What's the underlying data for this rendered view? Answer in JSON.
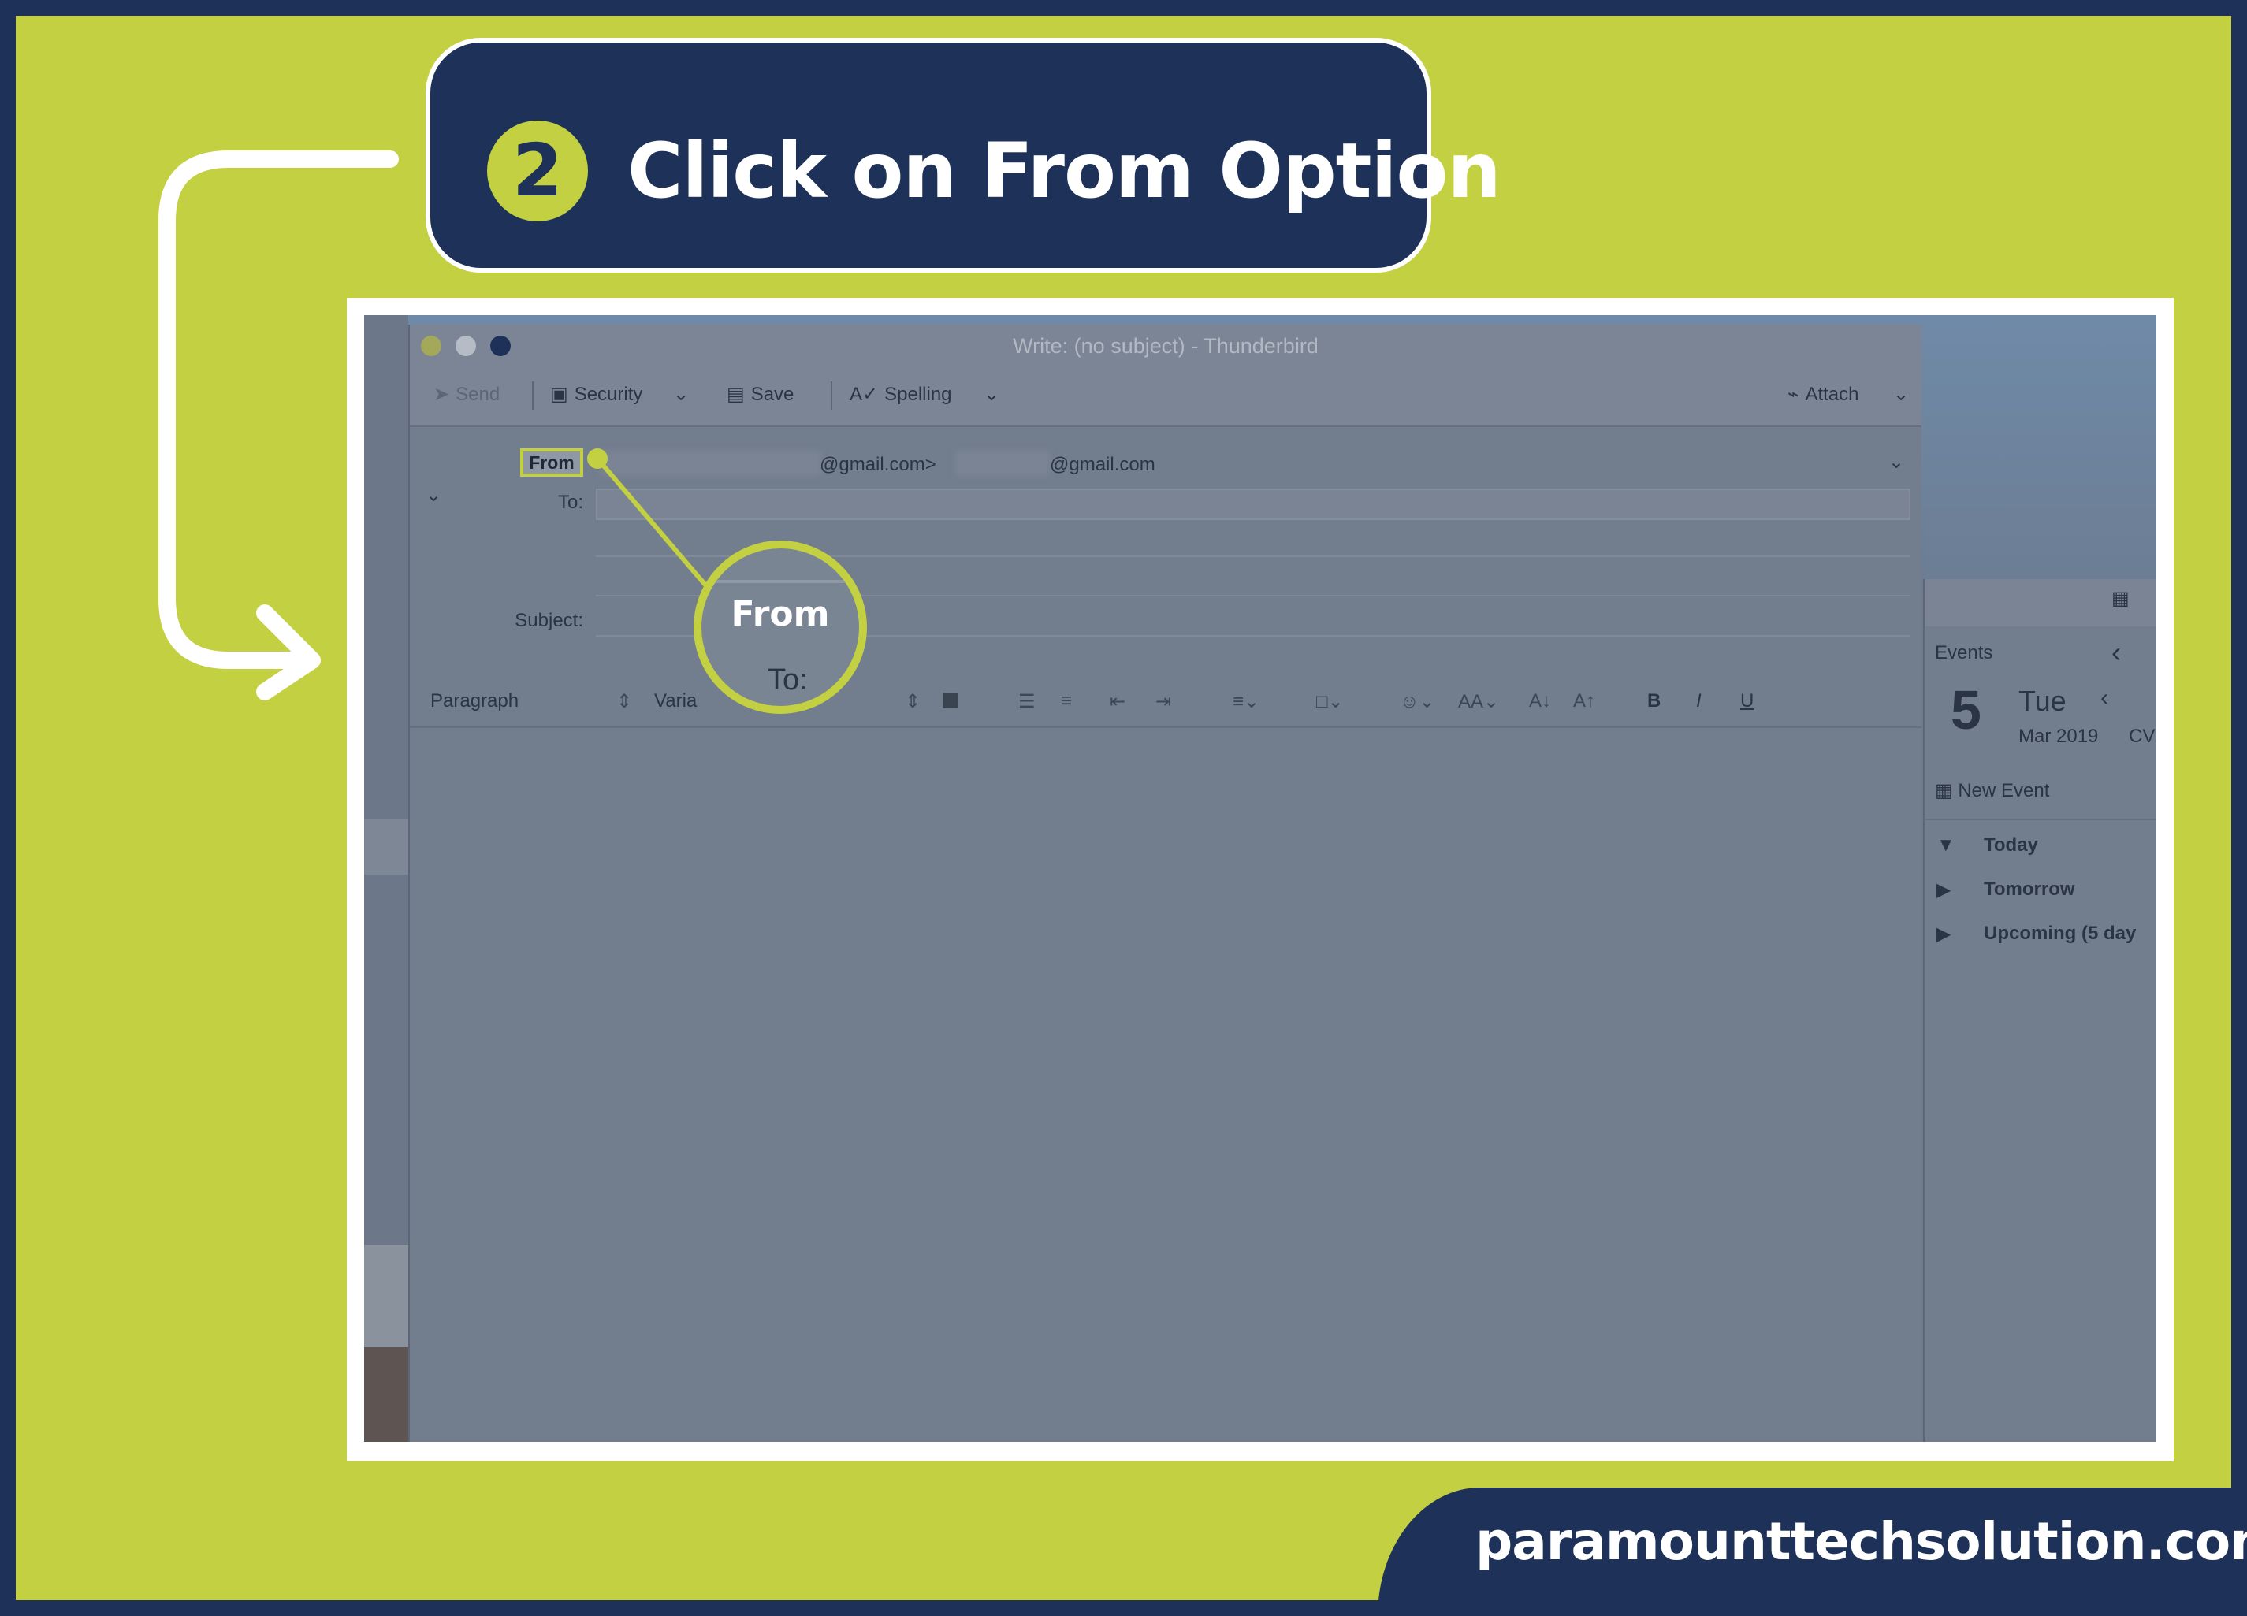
{
  "banner": {
    "step_number": "2",
    "text": "Click on From Option"
  },
  "window": {
    "title": "Write: (no subject) - Thunderbird",
    "toolbar": {
      "send": "Send",
      "security": "Security",
      "save": "Save",
      "spelling": "Spelling",
      "attach": "Attach"
    },
    "header": {
      "from_label": "From",
      "from_email_suffix": "@gmail.com>",
      "from_identity_suffix": "@gmail.com",
      "to_label": "To:",
      "subject_label": "Subject:"
    },
    "format": {
      "paragraph": "Paragraph",
      "font": "Varia",
      "bold": "B",
      "italic": "I",
      "underline": "U"
    }
  },
  "events_pane": {
    "title": "Events",
    "day_number": "5",
    "weekday": "Tue",
    "month_year": "Mar 2019",
    "week_label": "CV",
    "new_event": "New Event",
    "groups": [
      "Today",
      "Tomorrow",
      "Upcoming (5 day"
    ]
  },
  "zoom_callout": {
    "label": "From",
    "to_label": "To:"
  },
  "footer": {
    "website": "paramounttechsolution.com"
  },
  "colors": {
    "navy": "#1e3158",
    "lime": "#c2d042",
    "white": "#ffffff"
  }
}
